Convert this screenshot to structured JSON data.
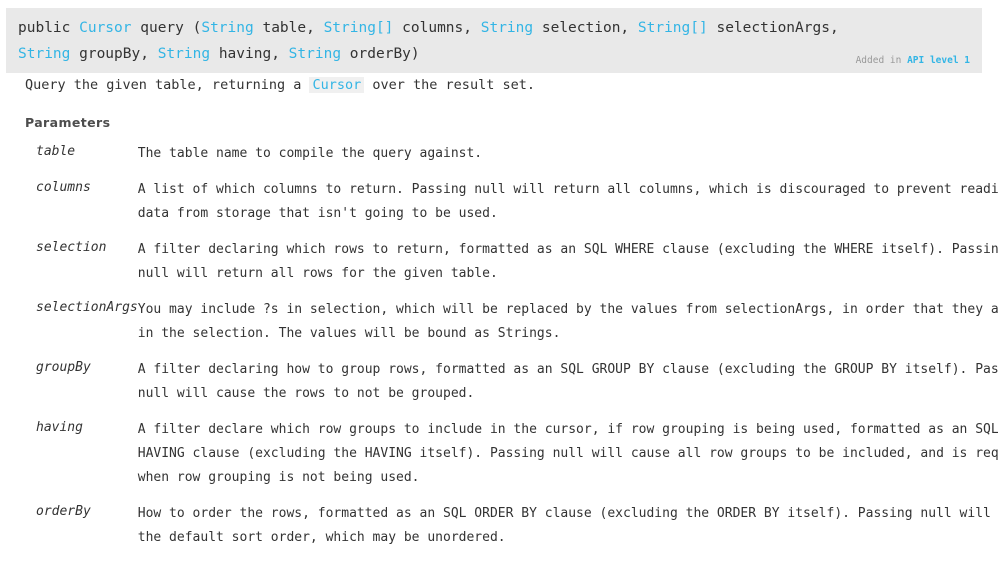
{
  "signature": {
    "tokens": [
      {
        "text": "public ",
        "kind": "plain"
      },
      {
        "text": "Cursor",
        "kind": "link"
      },
      {
        "text": " query (",
        "kind": "plain"
      },
      {
        "text": "String",
        "kind": "link"
      },
      {
        "text": " table, ",
        "kind": "plain"
      },
      {
        "text": "String[]",
        "kind": "link"
      },
      {
        "text": " columns, ",
        "kind": "plain"
      },
      {
        "text": "String",
        "kind": "link"
      },
      {
        "text": " selection, ",
        "kind": "plain"
      },
      {
        "text": "String[]",
        "kind": "link"
      },
      {
        "text": " selectionArgs, ",
        "kind": "plain"
      },
      {
        "text": "String",
        "kind": "link"
      },
      {
        "text": " groupBy, ",
        "kind": "plain"
      },
      {
        "text": "String",
        "kind": "link"
      },
      {
        "text": " having, ",
        "kind": "plain"
      },
      {
        "text": "String",
        "kind": "link"
      },
      {
        "text": " orderBy)",
        "kind": "plain"
      }
    ],
    "full_text": "public Cursor query (String table, String[] columns, String selection, String[] selectionArgs, String groupBy, String having, String orderBy)",
    "api_level": {
      "added_label": "Added in",
      "link_label": "API level 1"
    }
  },
  "description": {
    "before": "Query the given table, returning a",
    "code_link": "Cursor",
    "after": "over the result set."
  },
  "parameters": {
    "heading": "Parameters",
    "rows": [
      {
        "name": "table",
        "lines": [
          "The table name to compile the query against."
        ]
      },
      {
        "name": "columns",
        "lines": [
          "A list of which columns to return. Passing null will return all columns, which is discouraged to prevent reading",
          "data from storage that isn't going to be used."
        ]
      },
      {
        "name": "selection",
        "lines": [
          "A filter declaring which rows to return, formatted as an SQL WHERE clause (excluding the WHERE itself). Passing",
          "null will return all rows for the given table."
        ]
      },
      {
        "name": "selectionArgs",
        "lines": [
          "You may include ?s in selection, which will be replaced by the values from selectionArgs, in order that they appear",
          "in the selection. The values will be bound as Strings."
        ]
      },
      {
        "name": "groupBy",
        "lines": [
          "A filter declaring how to group rows, formatted as an SQL GROUP BY clause (excluding the GROUP BY itself). Passing",
          "null will cause the rows to not be grouped."
        ]
      },
      {
        "name": "having",
        "lines": [
          "A filter declare which row groups to include in the cursor, if row grouping is being used, formatted as an SQL",
          "HAVING clause (excluding the HAVING itself). Passing null will cause all row groups to be included, and is required",
          "when row grouping is not being used."
        ]
      },
      {
        "name": "orderBy",
        "lines": [
          "How to order the rows, formatted as an SQL ORDER BY clause (excluding the ORDER BY itself). Passing null will use",
          "the default sort order, which may be unordered."
        ]
      }
    ]
  },
  "colors": {
    "link": "#33b5e5",
    "header_background": "#e9e9e9",
    "text": "#333333",
    "muted": "#999999",
    "heading": "#4d4d4d",
    "code_background": "#f0f0f0"
  }
}
